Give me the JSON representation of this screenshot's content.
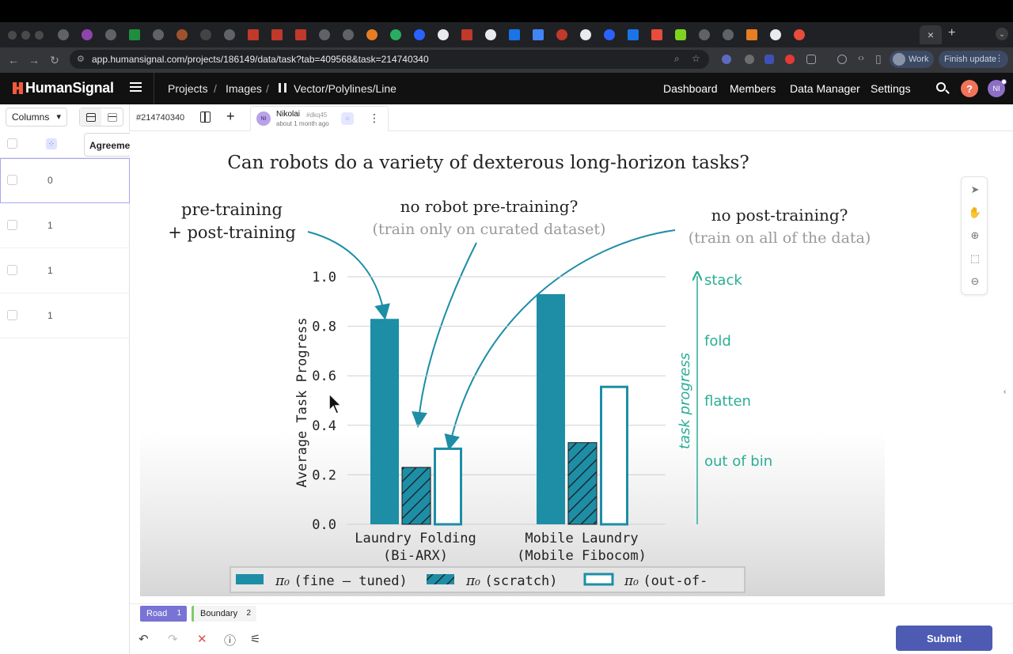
{
  "browser": {
    "url": "app.humansignal.com/projects/186149/data/task?tab=409568&task=214740340",
    "profile_label": "Work",
    "update_label": "Finish update",
    "tab_close": "×",
    "new_tab": "+"
  },
  "header": {
    "brand": "HumanSignal",
    "breadcrumb": [
      "Projects",
      "/",
      "Images",
      "/",
      "Vector/Polylines/Line"
    ],
    "nav": [
      "Dashboard",
      "Members",
      "Data Manager",
      "Settings"
    ],
    "help": "?",
    "user_initials": "NI"
  },
  "left_panel": {
    "columns_label": "Columns",
    "agreement_header": "Agreement",
    "rows": [
      "0",
      "1",
      "1",
      "1"
    ]
  },
  "task": {
    "id": "#214740340",
    "annotator_initials": "NI",
    "annotator_name": "Nikolai",
    "annotator_hash": "#dkq45",
    "annotated_time": "about 1 month ago",
    "more": "⋮",
    "add": "+"
  },
  "labels": [
    {
      "name": "Road",
      "count": "1",
      "color": "#7873d4"
    },
    {
      "name": "Boundary",
      "count": "2",
      "color": "#7fc96b"
    }
  ],
  "submit_label": "Submit",
  "slide": {
    "title": "Can robots do a variety of dexterous long-horizon tasks?",
    "ann_left": [
      "pre-training",
      "+ post-training"
    ],
    "ann_mid": [
      "no robot pre-training?",
      "(train only on curated dataset)"
    ],
    "ann_right": [
      "no post-training?",
      "(train on all of the data)"
    ],
    "progress_label": "task progress",
    "progress_steps": [
      "stack",
      "fold",
      "flatten",
      "out of bin"
    ],
    "colors": {
      "teal": "#1d8ea6",
      "accent": "#2bae96",
      "grey_text": "#9a9a9a",
      "dark": "#222222"
    }
  },
  "chart_data": {
    "type": "bar",
    "ylabel": "Average Task Progress",
    "ylim": [
      0,
      1.0
    ],
    "yticks": [
      "0.0",
      "0.2",
      "0.4",
      "0.6",
      "0.8",
      "1.0"
    ],
    "grid": true,
    "categories": [
      [
        "Laundry Folding",
        "(Bi-ARX)"
      ],
      [
        "Mobile Laundry",
        "(Mobile Fibocom)"
      ]
    ],
    "series": [
      {
        "name": "π₀ (fine – tuned)",
        "legend_text": "(fine – tuned)",
        "style": "solid",
        "values": [
          0.83,
          0.93
        ]
      },
      {
        "name": "π₀ (scratch)",
        "legend_text": "(scratch)",
        "style": "hatched",
        "values": [
          0.23,
          0.33
        ]
      },
      {
        "name": "π₀ (out-of-",
        "legend_text": "(out-of-",
        "style": "outline",
        "values": [
          0.31,
          0.56
        ]
      }
    ],
    "legend_placement": "bottom"
  }
}
